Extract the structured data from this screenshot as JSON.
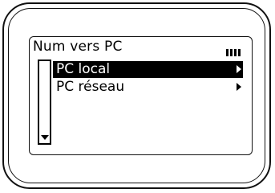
{
  "screen": {
    "title": "Num vers PC",
    "signal_bars": 4
  },
  "menu": {
    "items": [
      {
        "label": "PC local",
        "selected": true
      },
      {
        "label": "PC réseau",
        "selected": false
      }
    ]
  },
  "scrollbar": {
    "arrow": "down-arrow-icon"
  }
}
